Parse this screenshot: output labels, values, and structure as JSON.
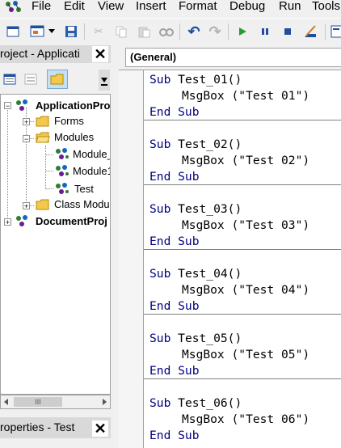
{
  "menu": [
    "File",
    "Edit",
    "View",
    "Insert",
    "Format",
    "Debug",
    "Run",
    "Tools"
  ],
  "toolbar_icons": [
    "view-excel-icon",
    "insert-userform-icon",
    "dropdown-arrow-icon",
    "save-icon",
    "cut-icon",
    "copy-icon",
    "paste-icon",
    "find-icon",
    "undo-icon",
    "redo-icon",
    "run-icon",
    "break-icon",
    "reset-icon",
    "design-mode-icon",
    "project-explorer-icon"
  ],
  "project": {
    "title": "roject - Applicati",
    "close": "✕",
    "tree": [
      {
        "label": "ApplicationPro",
        "bold": true
      },
      {
        "label": "Forms",
        "bold": false
      },
      {
        "label": "Modules",
        "bold": false
      },
      {
        "label": "Module_",
        "bold": false
      },
      {
        "label": "Module1",
        "bold": false
      },
      {
        "label": "Test",
        "bold": false
      },
      {
        "label": "Class Modul",
        "bold": false
      },
      {
        "label": "DocumentProj",
        "bold": true
      }
    ],
    "scroll_thumb": "III"
  },
  "properties": {
    "title": "roperties - Test",
    "close": "✕"
  },
  "code": {
    "object_dropdown": "(General)",
    "subs": [
      {
        "sub_kw": "Sub",
        "name": "Test_01()",
        "call": "MsgBox (\"Test 01\")",
        "end": "End Sub"
      },
      {
        "sub_kw": "Sub",
        "name": "Test_02()",
        "call": "MsgBox (\"Test 02\")",
        "end": "End Sub"
      },
      {
        "sub_kw": "Sub",
        "name": "Test_03()",
        "call": "MsgBox (\"Test 03\")",
        "end": "End Sub"
      },
      {
        "sub_kw": "Sub",
        "name": "Test_04()",
        "call": "MsgBox (\"Test 04\")",
        "end": "End Sub"
      },
      {
        "sub_kw": "Sub",
        "name": "Test_05()",
        "call": "MsgBox (\"Test 05\")",
        "end": "End Sub"
      },
      {
        "sub_kw": "Sub",
        "name": "Test_06()",
        "call": "MsgBox (\"Test 06\")",
        "end": "End Sub"
      }
    ]
  }
}
